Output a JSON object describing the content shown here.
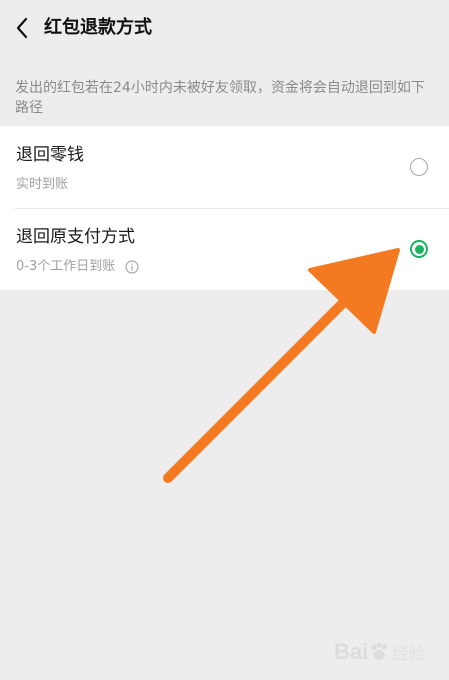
{
  "header": {
    "title": "红包退款方式"
  },
  "notice": "发出的红包若在24小时内未被好友领取，资金将会自动退回到如下路径",
  "options": [
    {
      "label": "退回零钱",
      "sub": "实时到账",
      "selected": false
    },
    {
      "label": "退回原支付方式",
      "sub": "0-3个工作日到账",
      "selected": true
    }
  ],
  "colors": {
    "accent": "#19b35f",
    "arrow": "#f47a21",
    "background": "#ededed"
  },
  "icons": {
    "back": "chevron-left-icon",
    "info": "info-circle-icon"
  },
  "watermark": {
    "brand": "Bai",
    "suffix": "经验"
  }
}
